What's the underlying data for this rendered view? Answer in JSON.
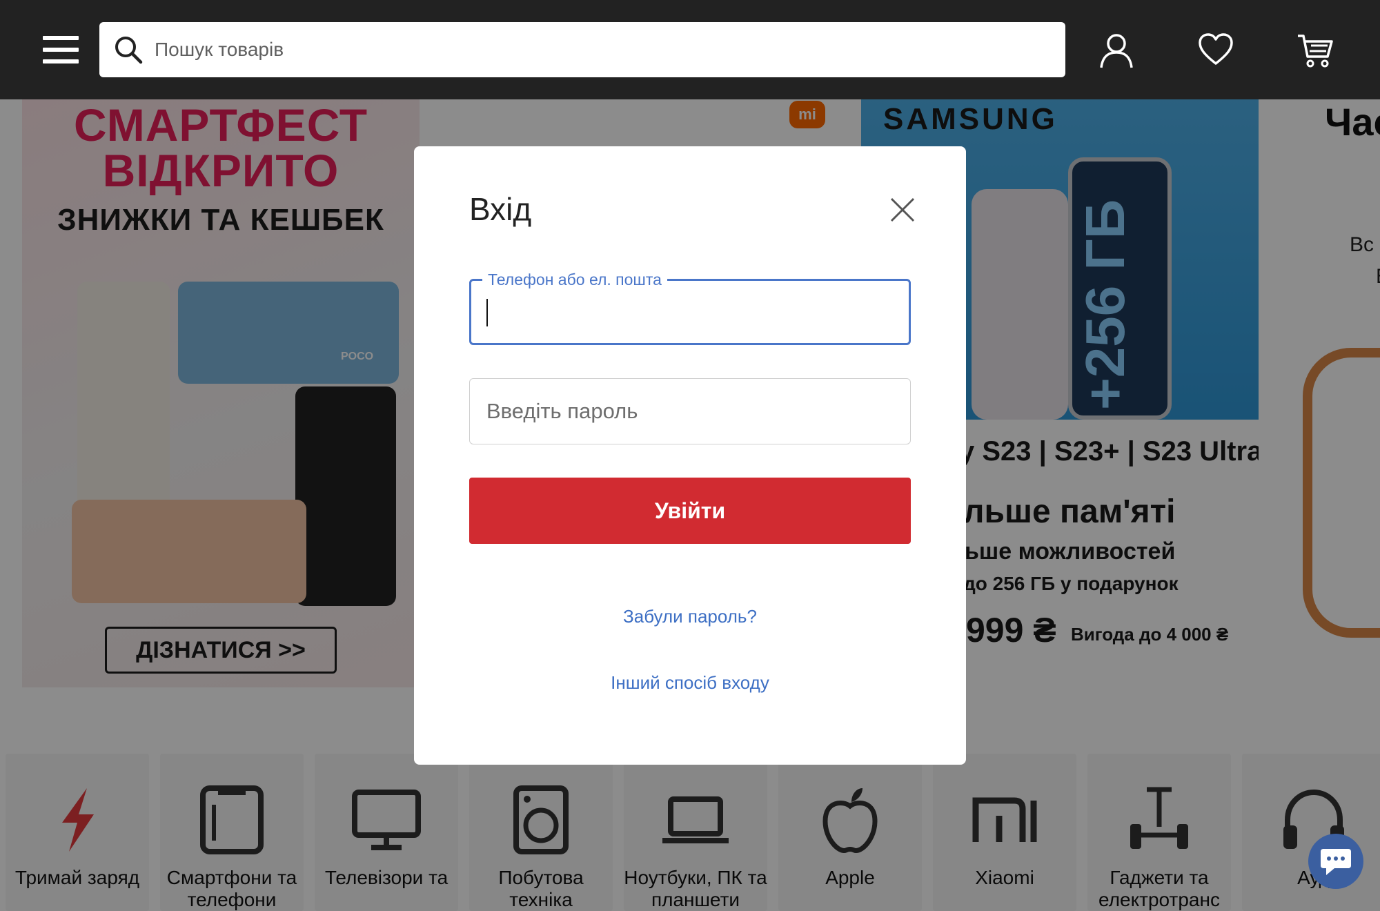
{
  "header": {
    "search_placeholder": "Пошук товарів",
    "icons": [
      "menu-icon",
      "search-icon",
      "user-icon",
      "heart-icon",
      "cart-icon"
    ]
  },
  "banners": {
    "smartfest": {
      "line1": "СМАРТФЕСТ",
      "line2": "ВІДКРИТО",
      "subtitle": "ЗНИЖКИ ТА КЕШБЕК",
      "cta": "ДІЗНАТИСЯ >>",
      "phone_label": "POCO"
    },
    "xiaomi_logo": "mi",
    "samsung": {
      "brand": "SAMSUNG",
      "storage": "+256 ГБ",
      "models": "y S23 | S23+ | S23 Ultra",
      "headline": "льше пам'яті",
      "subline": "ьше можливостей",
      "gift": "до 256 ГБ у подарунок",
      "price": "999 ₴",
      "savings": "Вигода до 4 000 ₴"
    },
    "partial": {
      "title": "Час",
      "line1": "Вс",
      "line2": "Е"
    }
  },
  "categories": [
    {
      "label": "Тримай заряд",
      "icon": "lightning-icon"
    },
    {
      "label": "Смартфони та телефони",
      "icon": "smartphone-icon"
    },
    {
      "label": "Телевізори та",
      "icon": "tv-icon"
    },
    {
      "label": "Побутова техніка",
      "icon": "washing-machine-icon"
    },
    {
      "label": "Ноутбуки, ПК та планшети",
      "icon": "laptop-icon"
    },
    {
      "label": "Apple",
      "icon": "apple-icon"
    },
    {
      "label": "Xiaomi",
      "icon": "xiaomi-icon"
    },
    {
      "label": "Гаджети та електротранс",
      "icon": "scooter-icon"
    },
    {
      "label": "Ауд",
      "icon": "headphones-icon"
    }
  ],
  "modal": {
    "title": "Вхід",
    "login_label": "Телефон або ел. пошта",
    "login_value": "",
    "password_placeholder": "Введіть пароль",
    "submit": "Увійти",
    "forgot": "Забули пароль?",
    "other": "Інший спосіб входу"
  },
  "colors": {
    "header_bg": "#222222",
    "accent_red": "#d12b31",
    "link_blue": "#3d6fc4",
    "focus_blue": "#4a76c9",
    "chat_button": "#3b5fa0"
  }
}
